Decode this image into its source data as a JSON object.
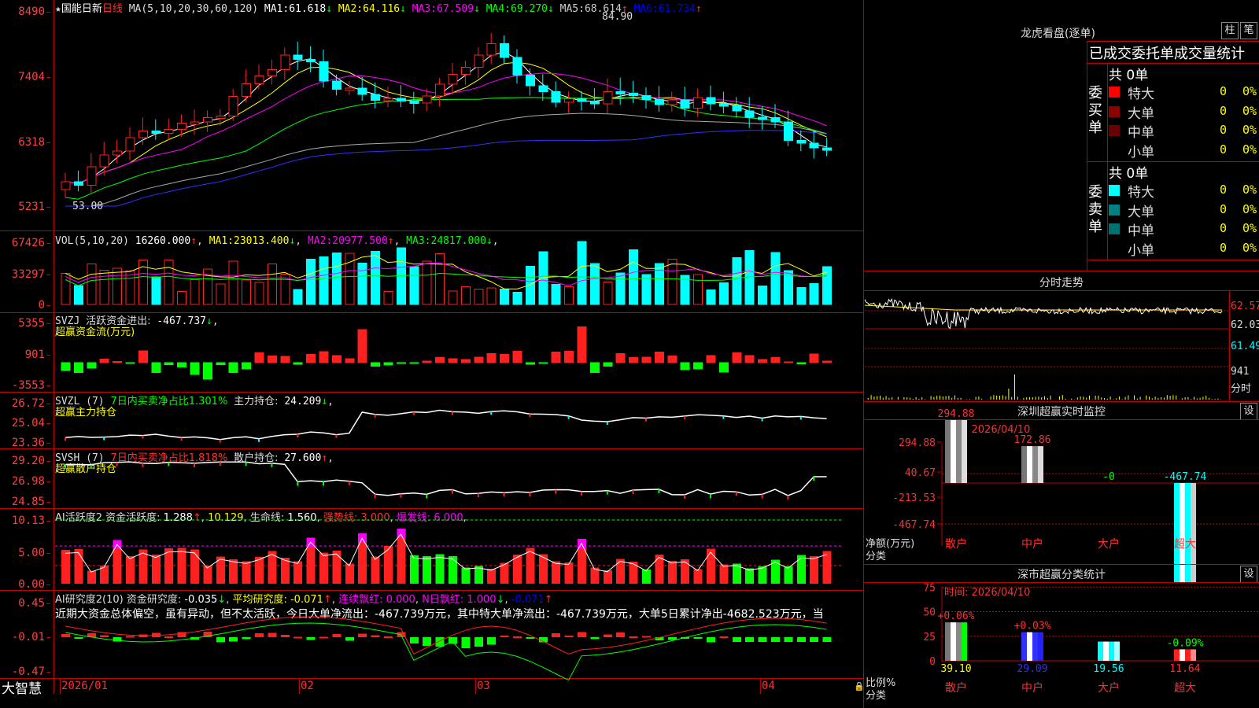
{
  "stock": {
    "star": "★",
    "name": "国能日新",
    "period": "日线"
  },
  "brand": "大智慧",
  "colors": {
    "up": "#ff0000",
    "down": "#00ffff",
    "grid": "#c00000",
    "ma1": "#ffffff",
    "ma2": "#ffff00",
    "ma3": "#ff00ff",
    "ma4": "#00ff00",
    "ma5": "#aaaaaa",
    "ma6": "#0000ff"
  },
  "price_panel": {
    "ma_params": "MA(5,10,20,30,60,120)",
    "ma_values": [
      {
        "label": "MA1:",
        "value": "61.618",
        "arrow": "↓",
        "color": "#ffffff"
      },
      {
        "label": "MA2:",
        "value": "64.116",
        "arrow": "↓",
        "color": "#ffff00"
      },
      {
        "label": "MA3:",
        "value": "67.509",
        "arrow": "↓",
        "color": "#ff00ff"
      },
      {
        "label": "MA4:",
        "value": "69.270",
        "arrow": "↓",
        "color": "#00ff00"
      },
      {
        "label": "MA5:",
        "value": "68.614",
        "arrow": "↑",
        "color": "#cccccc"
      },
      {
        "label": "MA6:",
        "value": "61.734",
        "arrow": "↑",
        "color": "#0000ff"
      }
    ],
    "y_ticks": [
      "8490",
      "7404",
      "6318",
      "5231"
    ],
    "high_mark": "84.90",
    "low_mark": "53.00"
  },
  "vol_panel": {
    "params": "VOL(5,10,20)",
    "value": "16260.000",
    "value_arrow": "↑",
    "mas": [
      {
        "label": "MA1:",
        "value": "23013.400",
        "arrow": "↓",
        "color": "#ffff00"
      },
      {
        "label": "MA2:",
        "value": "20977.500",
        "arrow": "↑",
        "color": "#ff00ff"
      },
      {
        "label": "MA3:",
        "value": "24817.000",
        "arrow": "↓",
        "color": "#00ff00"
      }
    ],
    "y_ticks": [
      "67426",
      "33297",
      "0"
    ]
  },
  "svzj_panel": {
    "label": "SVZJ",
    "desc": "活跃资金进出:",
    "value": "-467.737",
    "arrow": "↓",
    "title": "超赢资金流(万元)",
    "y_ticks": [
      "5355",
      "901",
      "-3553"
    ]
  },
  "svzl_panel": {
    "label": "SVZL (7)",
    "desc": "7日内买卖净占比1.301%",
    "desc2": "主力持仓:",
    "value": "24.209",
    "arrow": "↓",
    "title": "超赢主力持仓",
    "y_ticks": [
      "26.72",
      "25.04",
      "23.36"
    ]
  },
  "svsh_panel": {
    "label": "SVSH (7)",
    "desc": "7日内买卖净占比1.818%",
    "desc2": "散户持仓:",
    "value": "27.600",
    "arrow": "↑",
    "title": "超赢散户持仓",
    "y_ticks": [
      "29.20",
      "26.98",
      "24.85"
    ]
  },
  "ai_panel": {
    "label": "AI活跃度2",
    "d1": "资金活跃度:",
    "v1": "1.288",
    "a1": "↑",
    "v2": "10.129",
    "d3": "生命线:",
    "v3": "1.560",
    "d4": "强势线:",
    "v4": "3.000",
    "d5": "爆发线:",
    "v5": "6.000",
    "y_ticks": [
      "10.13",
      "5.00",
      "0.00"
    ]
  },
  "research_panel": {
    "label": "AI研究度2(10)",
    "d1": "资金研究度:",
    "v1": "-0.035",
    "a1": "↓",
    "d2": "平均研究度:",
    "v2": "-0.071",
    "a2": "↑",
    "d3": "连续飘红:",
    "v3": "0.000",
    "d4": "N日飘红:",
    "v4": "1.000",
    "a4": "↓",
    "v5": "-0.071",
    "a5": "↑",
    "text": "近期大资金总体偏空，虽有异动，但不太活跃，今日大单净流出：-467.739万元，其中特大单净流出：-467.739万元，大单5日累计净出-4682.523万元，当",
    "y_ticks": [
      "0.45",
      "-0.01",
      "-0.47"
    ]
  },
  "x_axis": {
    "labels": [
      "2026/01",
      "02",
      "03",
      "04"
    ]
  },
  "dragon": {
    "title": "龙虎看盘(逐单)",
    "btn_bar": "柱",
    "btn_pen": "笔",
    "subtitle": "已成交委托单成交量统计",
    "buy_label": "委买单",
    "sell_label": "委卖单",
    "buy_total": "共 0单",
    "sell_total": "共 0单",
    "buy_rows": [
      {
        "name": "特大",
        "val": "0",
        "pct": "0%",
        "color": "#ff0000"
      },
      {
        "name": "大单",
        "val": "0",
        "pct": "0%",
        "color": "#8b0000"
      },
      {
        "name": "中单",
        "val": "0",
        "pct": "0%",
        "color": "#6b0000"
      },
      {
        "name": "小单",
        "val": "0",
        "pct": "0%",
        "color": ""
      }
    ],
    "sell_rows": [
      {
        "name": "特大",
        "val": "0",
        "pct": "0%",
        "color": "#00ffff"
      },
      {
        "name": "大单",
        "val": "0",
        "pct": "0%",
        "color": "#008080"
      },
      {
        "name": "中单",
        "val": "0",
        "pct": "0%",
        "color": "#007070"
      },
      {
        "name": "小单",
        "val": "0",
        "pct": "0%",
        "color": ""
      }
    ]
  },
  "intraday": {
    "title": "分时走势",
    "y_ticks": [
      "62.57",
      "62.03",
      "61.49",
      "941",
      "分时"
    ]
  },
  "sz_monitor": {
    "title": "深圳超赢实时监控",
    "set_btn": "设",
    "time": "时间: 2026/04/10",
    "y_ticks": [
      "294.88",
      "40.67",
      "-213.53",
      "-467.74"
    ],
    "y_label": "净额(万元)",
    "x_label": "分类",
    "categories": [
      "散户",
      "中户",
      "大户",
      "超大"
    ],
    "values": [
      294.88,
      172.86,
      0,
      -467.74
    ],
    "value_labels": [
      "294.88",
      "172.86",
      "-0",
      "-467.74"
    ]
  },
  "sz_classify": {
    "title": "深市超赢分类统计",
    "set_btn": "设",
    "time": "时间: 2026/04/10",
    "y_ticks": [
      "75",
      "50",
      "25",
      "0"
    ],
    "y_label": "比例%",
    "x_label": "分类",
    "categories": [
      "散户",
      "中户",
      "大户",
      "超大"
    ],
    "values": [
      39.1,
      29.09,
      19.56,
      11.64
    ],
    "value_labels": [
      "39.10",
      "29.09",
      "19.56",
      "11.64"
    ],
    "change_labels": [
      "+0.06%",
      "+0.03%",
      "",
      "-0.09%"
    ]
  }
}
